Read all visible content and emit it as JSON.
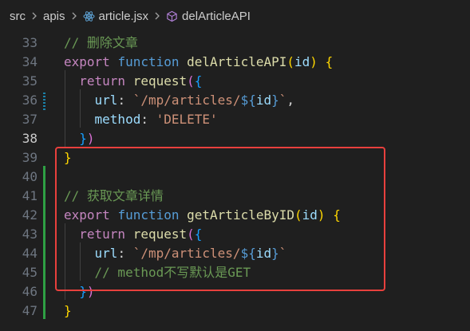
{
  "breadcrumb": {
    "items": [
      "src",
      "apis",
      "article.jsx",
      "delArticleAPI"
    ],
    "icons": [
      "react-icon",
      "method-cube-icon"
    ]
  },
  "editor": {
    "line_numbers": [
      "33",
      "34",
      "35",
      "36",
      "37",
      "38",
      "39",
      "40",
      "41",
      "42",
      "43",
      "44",
      "45",
      "46",
      "47"
    ],
    "active_line": "38",
    "lines": [
      [
        {
          "t": "// 删除文章",
          "c": "cm"
        }
      ],
      [
        {
          "t": "export",
          "c": "kw2"
        },
        {
          "t": " ",
          "c": "tx"
        },
        {
          "t": "function",
          "c": "kw"
        },
        {
          "t": " ",
          "c": "tx"
        },
        {
          "t": "delArticleAPI",
          "c": "fn"
        },
        {
          "t": "(",
          "c": "b1"
        },
        {
          "t": "id",
          "c": "pm"
        },
        {
          "t": ")",
          "c": "b1"
        },
        {
          "t": " ",
          "c": "tx"
        },
        {
          "t": "{",
          "c": "b1"
        }
      ],
      [
        {
          "t": "  ",
          "c": "tx"
        },
        {
          "t": "return",
          "c": "kw2"
        },
        {
          "t": " ",
          "c": "tx"
        },
        {
          "t": "request",
          "c": "fn"
        },
        {
          "t": "(",
          "c": "b2"
        },
        {
          "t": "{",
          "c": "b3"
        }
      ],
      [
        {
          "t": "    ",
          "c": "tx"
        },
        {
          "t": "url",
          "c": "pm"
        },
        {
          "t": ": ",
          "c": "tx"
        },
        {
          "t": "`/mp/articles/",
          "c": "st"
        },
        {
          "t": "${",
          "c": "kw"
        },
        {
          "t": "id",
          "c": "pm"
        },
        {
          "t": "}",
          "c": "kw"
        },
        {
          "t": "`",
          "c": "st"
        },
        {
          "t": ",",
          "c": "tx"
        }
      ],
      [
        {
          "t": "    ",
          "c": "tx"
        },
        {
          "t": "method",
          "c": "pm"
        },
        {
          "t": ": ",
          "c": "tx"
        },
        {
          "t": "'DELETE'",
          "c": "st"
        }
      ],
      [
        {
          "t": "  ",
          "c": "tx"
        },
        {
          "t": "}",
          "c": "b3"
        },
        {
          "t": ")",
          "c": "b2"
        }
      ],
      [
        {
          "t": "}",
          "c": "b1"
        }
      ],
      [],
      [
        {
          "t": "// 获取文章详情",
          "c": "cm"
        }
      ],
      [
        {
          "t": "export",
          "c": "kw2"
        },
        {
          "t": " ",
          "c": "tx"
        },
        {
          "t": "function",
          "c": "kw"
        },
        {
          "t": " ",
          "c": "tx"
        },
        {
          "t": "getArticleByID",
          "c": "fn"
        },
        {
          "t": "(",
          "c": "b1"
        },
        {
          "t": "id",
          "c": "pm"
        },
        {
          "t": ")",
          "c": "b1"
        },
        {
          "t": " ",
          "c": "tx"
        },
        {
          "t": "{",
          "c": "b1"
        }
      ],
      [
        {
          "t": "  ",
          "c": "tx"
        },
        {
          "t": "return",
          "c": "kw2"
        },
        {
          "t": " ",
          "c": "tx"
        },
        {
          "t": "request",
          "c": "fn"
        },
        {
          "t": "(",
          "c": "b2"
        },
        {
          "t": "{",
          "c": "b3"
        }
      ],
      [
        {
          "t": "    ",
          "c": "tx"
        },
        {
          "t": "url",
          "c": "pm"
        },
        {
          "t": ": ",
          "c": "tx"
        },
        {
          "t": "`/mp/articles/",
          "c": "st"
        },
        {
          "t": "${",
          "c": "kw"
        },
        {
          "t": "id",
          "c": "pm"
        },
        {
          "t": "}",
          "c": "kw"
        },
        {
          "t": "`",
          "c": "st"
        }
      ],
      [
        {
          "t": "    ",
          "c": "tx"
        },
        {
          "t": "// method不写默认是GET",
          "c": "cm"
        }
      ],
      [
        {
          "t": "  ",
          "c": "tx"
        },
        {
          "t": "}",
          "c": "b3"
        },
        {
          "t": ")",
          "c": "b2"
        }
      ],
      [
        {
          "t": "}",
          "c": "b1"
        }
      ]
    ]
  }
}
